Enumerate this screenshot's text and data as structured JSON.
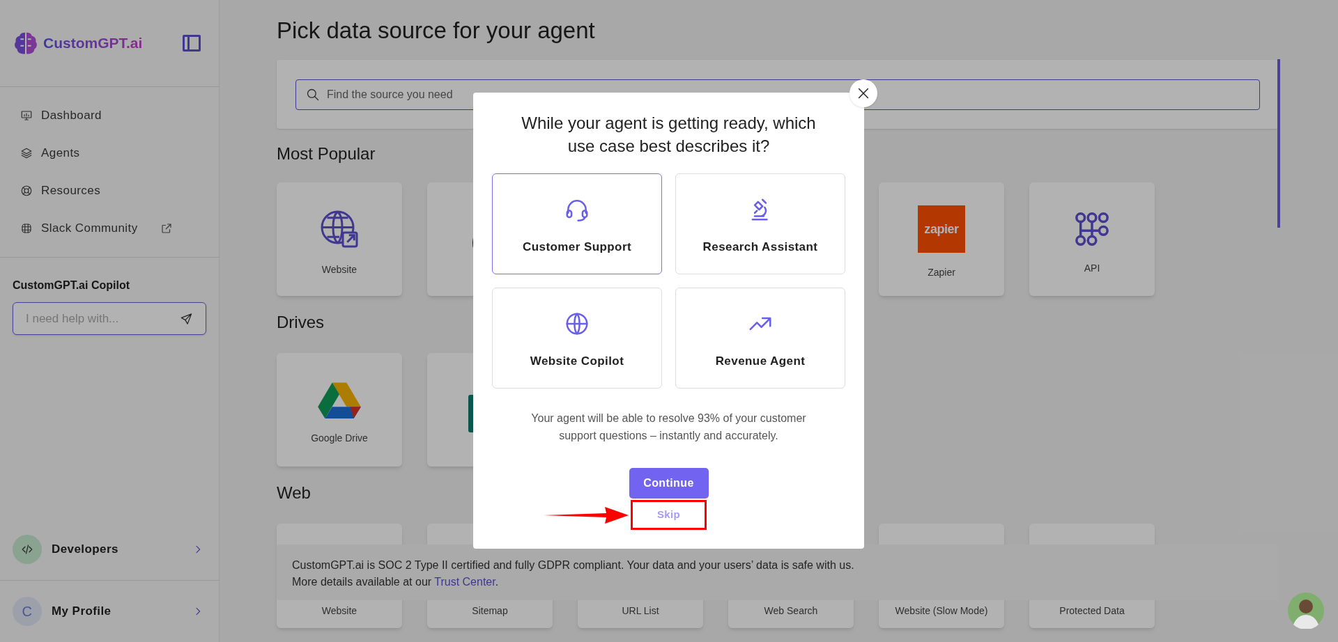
{
  "sidebar": {
    "logo": "CustomGPT.ai",
    "nav": [
      {
        "label": "Dashboard",
        "external": false
      },
      {
        "label": "Agents",
        "external": false
      },
      {
        "label": "Resources",
        "external": false
      },
      {
        "label": "Slack Community",
        "external": true
      }
    ],
    "copilot": {
      "title": "CustomGPT.ai Copilot",
      "placeholder": "I need help with..."
    },
    "developers": {
      "label": "Developers"
    },
    "profile": {
      "initial": "C",
      "label": "My Profile"
    }
  },
  "main": {
    "title": "Pick data source for your agent",
    "search": {
      "placeholder": "Find the source you need"
    },
    "sections": [
      {
        "title": "Most Popular",
        "cards": [
          {
            "kind": "website",
            "label": "Website"
          },
          {
            "kind": "wordpress"
          },
          {
            "kind": "zapier",
            "label": "Zapier",
            "logo_text": "zapier"
          },
          {
            "kind": "api",
            "label": "API"
          }
        ]
      },
      {
        "title": "Drives",
        "cards": [
          {
            "kind": "drive",
            "label": "Google Drive"
          },
          {
            "kind": "sheet"
          }
        ]
      },
      {
        "title": "Web",
        "cards": [
          {
            "kind": "covered",
            "label": "Website"
          },
          {
            "kind": "covered",
            "label": "Sitemap"
          },
          {
            "kind": "covered",
            "label": "URL List"
          },
          {
            "kind": "covered",
            "label": "Web Search"
          },
          {
            "kind": "covered",
            "label": "Website (Slow Mode)"
          },
          {
            "kind": "covered",
            "label": "Protected Data"
          }
        ]
      }
    ],
    "notice": {
      "text": "CustomGPT.ai is SOC 2 Type II certified and fully GDPR compliant. Your data and your users’ data is safe with us.",
      "more": "More details available at our",
      "link": "Trust Center",
      "end": "."
    }
  },
  "modal": {
    "title": "While your agent is getting ready, which use case best describes it?",
    "options": [
      {
        "label": "Customer Support",
        "selected": true
      },
      {
        "label": "Research Assistant",
        "selected": false
      },
      {
        "label": "Website Copilot",
        "selected": false
      },
      {
        "label": "Revenue Agent",
        "selected": false
      }
    ],
    "description": "Your agent will be able to resolve 93% of your customer support questions – instantly and accurately.",
    "continue": "Continue",
    "skip": "Skip"
  }
}
